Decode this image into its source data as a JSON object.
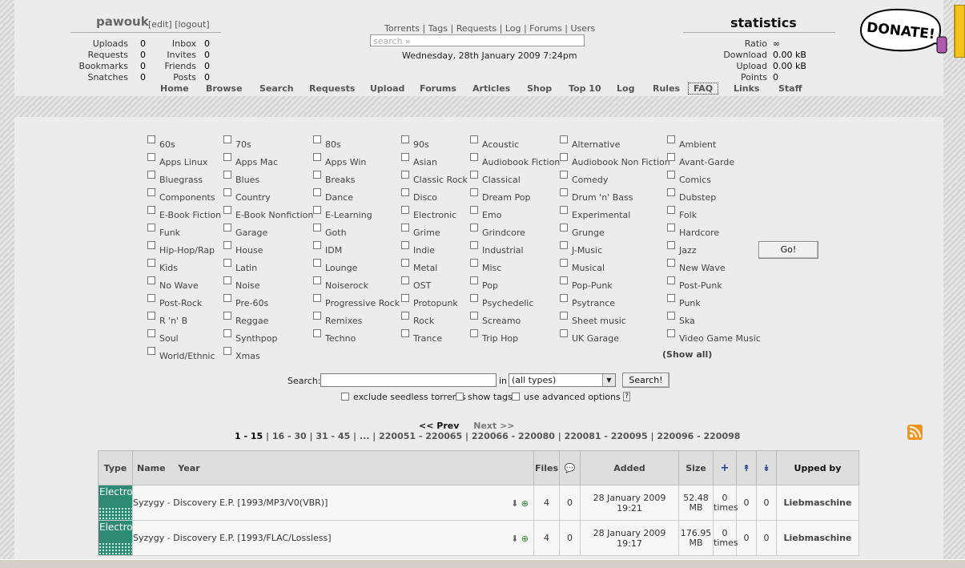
{
  "user": {
    "name": "pawouk",
    "edit": "[edit]",
    "logout": "[logout]"
  },
  "user_stats": [
    {
      "label": "Uploads",
      "value": "0"
    },
    {
      "label": "Requests",
      "value": "0"
    },
    {
      "label": "Bookmarks",
      "value": "0"
    },
    {
      "label": "Snatches",
      "value": "0"
    }
  ],
  "user_stats2": [
    {
      "label": "Inbox",
      "value": "0"
    },
    {
      "label": "Invites",
      "value": "0"
    },
    {
      "label": "Friends",
      "value": "0"
    },
    {
      "label": "Posts",
      "value": "0"
    }
  ],
  "top_links": "Torrents | Tags | Requests | Log | Forums | Users",
  "search_placeholder": "search »",
  "date": "Wednesday, 28th January 2009 7:24pm",
  "statistics": {
    "title": "statistics",
    "rows": [
      {
        "label": "Ratio",
        "value": "∞"
      },
      {
        "label": "Download",
        "value": "0.00 kB"
      },
      {
        "label": "Upload",
        "value": "0.00 kB"
      },
      {
        "label": "Points",
        "value": "0"
      }
    ]
  },
  "donate": "DONATE!",
  "nav": [
    "Home",
    "Browse",
    "Search",
    "Requests",
    "Upload",
    "Forums",
    "Articles",
    "Shop",
    "Top 10",
    "Log",
    "Rules",
    "FAQ",
    "Links",
    "Staff"
  ],
  "nav_active": "FAQ",
  "tags": [
    [
      "60s",
      "70s",
      "80s",
      "90s",
      "Acoustic",
      "Alternative",
      "Ambient"
    ],
    [
      "Apps Linux",
      "Apps Mac",
      "Apps Win",
      "Asian",
      "Audiobook Fiction",
      "Audiobook Non Fiction",
      "Avant-Garde"
    ],
    [
      "Bluegrass",
      "Blues",
      "Breaks",
      "Classic Rock",
      "Classical",
      "Comedy",
      "Comics"
    ],
    [
      "Components",
      "Country",
      "Dance",
      "Disco",
      "Dream Pop",
      "Drum 'n' Bass",
      "Dubstep"
    ],
    [
      "E-Book Fiction",
      "E-Book Nonfiction",
      "E-Learning",
      "Electronic",
      "Emo",
      "Experimental",
      "Folk"
    ],
    [
      "Funk",
      "Garage",
      "Goth",
      "Grime",
      "Grindcore",
      "Grunge",
      "Hardcore"
    ],
    [
      "Hip-Hop/Rap",
      "House",
      "IDM",
      "Indie",
      "Industrial",
      "J-Music",
      "Jazz"
    ],
    [
      "Kids",
      "Latin",
      "Lounge",
      "Metal",
      "Misc",
      "Musical",
      "New Wave"
    ],
    [
      "No Wave",
      "Noise",
      "Noiserock",
      "OST",
      "Pop",
      "Pop-Punk",
      "Post-Punk"
    ],
    [
      "Post-Rock",
      "Pre-60s",
      "Progressive Rock",
      "Protopunk",
      "Psychedelic",
      "Psytrance",
      "Punk"
    ],
    [
      "R 'n' B",
      "Reggae",
      "Remixes",
      "Rock",
      "Screamo",
      "Sheet music",
      "Ska"
    ],
    [
      "Soul",
      "Synthpop",
      "Techno",
      "Trance",
      "Trip Hop",
      "UK Garage",
      "Video Game Music"
    ],
    [
      "World/Ethnic",
      "Xmas"
    ]
  ],
  "show_all": "(Show all)",
  "go_button": "Go!",
  "search": {
    "label": "Search:",
    "in": "in",
    "type_value": "(all types)",
    "button": "Search!"
  },
  "options": {
    "exclude": "exclude seedless torrents",
    "show_tags": "show tags",
    "advanced": "use advanced options",
    "help": "?"
  },
  "pagination": {
    "prev": "<< Prev",
    "next": "Next >>",
    "current": "1 - 15",
    "rest": " | 16 - 30 | 31 - 45 | ... | 220051 - 220065 | 220066 - 220080 | 220081 - 220095 | 220096 - 220098"
  },
  "table": {
    "headers": {
      "type": "Type",
      "name": "Name",
      "year": "Year",
      "files": "Files",
      "added": "Added",
      "size": "Size",
      "snatched": "+",
      "seeders": "↟",
      "leechers": "↡",
      "upped_by": "Upped by"
    },
    "rows": [
      {
        "type": "Electronic",
        "name": "Syzygy - Discovery E.P. [1993/MP3/V0(VBR)]",
        "files": "4",
        "comments": "0",
        "added": "28 January 2009 19:21",
        "size1": "52.48",
        "size2": "MB",
        "snatched1": "0",
        "snatched2": "times",
        "seeders": "0",
        "leechers": "0",
        "upped_by": "Liebmaschine"
      },
      {
        "type": "Electronic",
        "name": "Syzygy - Discovery E.P. [1993/FLAC/Lossless]",
        "files": "4",
        "comments": "0",
        "added": "28 January 2009 19:17",
        "size1": "176.95",
        "size2": "MB",
        "snatched1": "0",
        "snatched2": "times",
        "seeders": "0",
        "leechers": "0",
        "upped_by": "Liebmaschine"
      }
    ]
  }
}
